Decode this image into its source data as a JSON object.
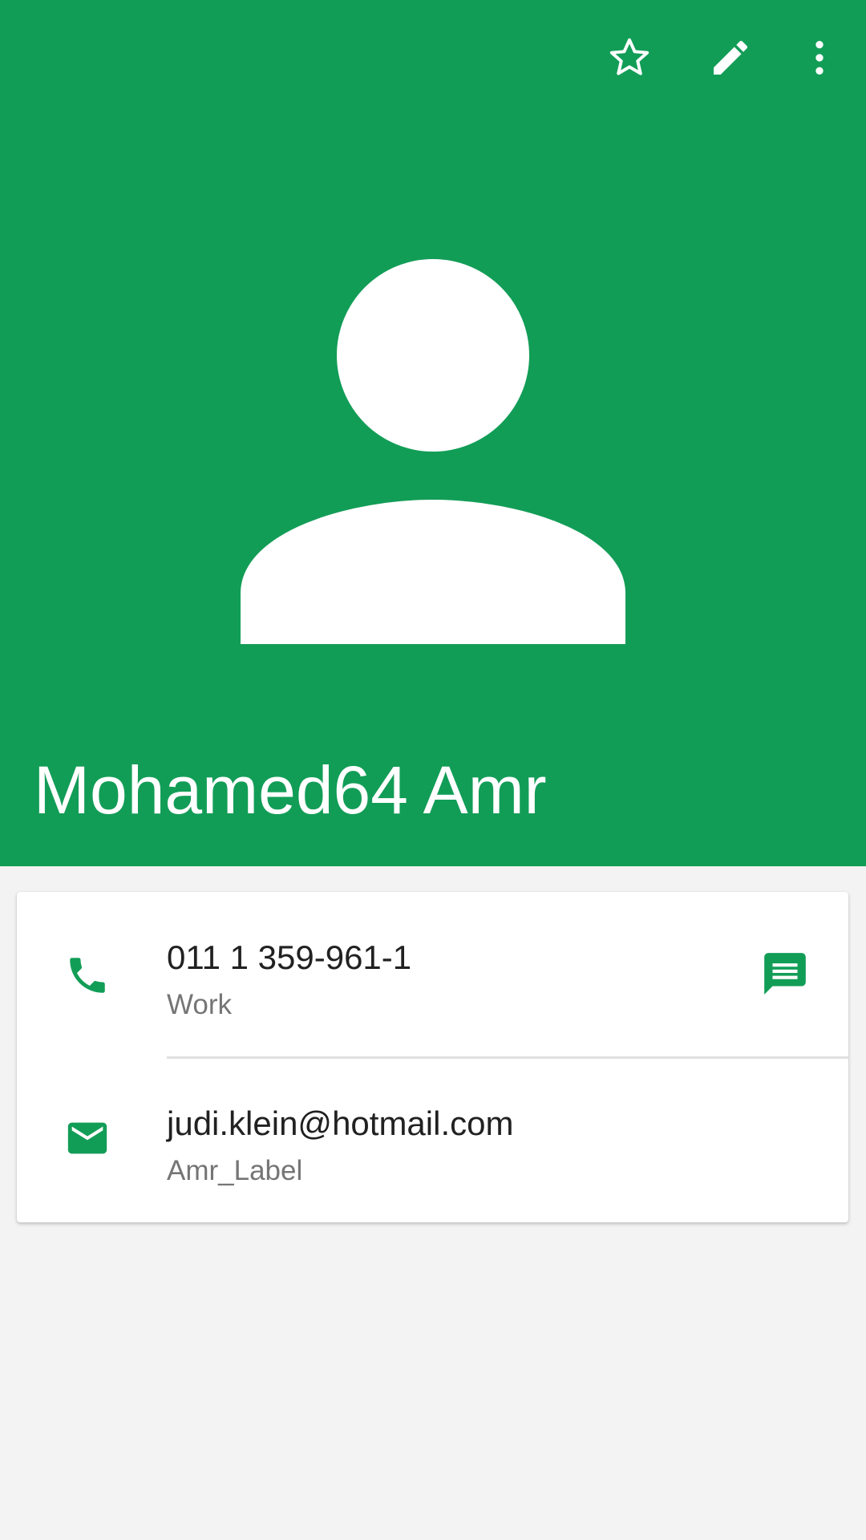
{
  "colors": {
    "header_bg": "#129d57",
    "accent": "#129d57",
    "page_bg": "#f3f3f3",
    "card_bg": "#ffffff",
    "primary_text": "#212121",
    "secondary_text": "#757575"
  },
  "toolbar": {
    "actions": [
      {
        "icon": "star-outline-icon",
        "label": "Add to favorites"
      },
      {
        "icon": "pencil-icon",
        "label": "Edit contact"
      },
      {
        "icon": "more-vert-icon",
        "label": "More options"
      }
    ]
  },
  "contact": {
    "name": "Mohamed64 Amr",
    "avatar_icon": "person-placeholder-icon"
  },
  "details": {
    "phone": {
      "icon": "phone-icon",
      "number": "011 1 359-961-1",
      "type": "Work",
      "action_icon": "message-icon"
    },
    "email": {
      "icon": "email-icon",
      "address": "judi.klein@hotmail.com",
      "label": "Amr_Label"
    }
  }
}
